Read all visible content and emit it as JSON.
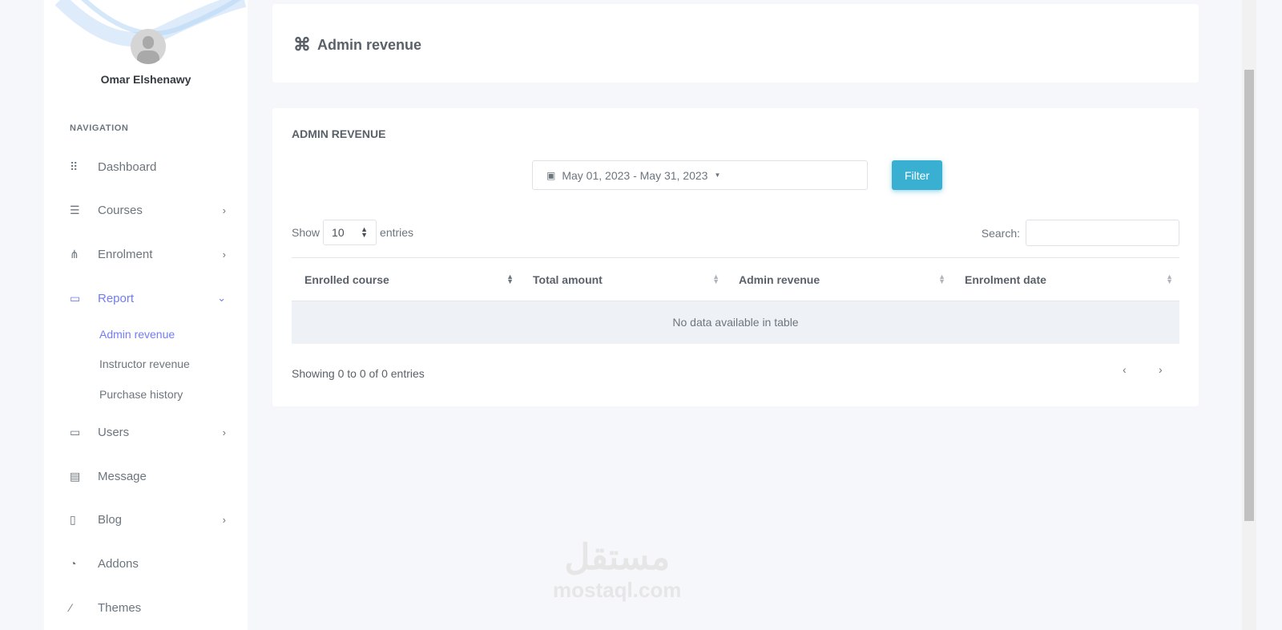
{
  "user": {
    "name": "Omar Elshenawy"
  },
  "nav": {
    "heading": "NAVIGATION",
    "items": [
      {
        "label": "Dashboard",
        "icon": "grid-icon"
      },
      {
        "label": "Courses",
        "icon": "archive-icon"
      },
      {
        "label": "Enrolment",
        "icon": "sitemap-icon"
      },
      {
        "label": "Report",
        "icon": "box-icon"
      },
      {
        "label": "Users",
        "icon": "box-icon"
      },
      {
        "label": "Message",
        "icon": "message-icon"
      },
      {
        "label": "Blog",
        "icon": "document-icon"
      },
      {
        "label": "Addons",
        "icon": "puzzle-icon"
      },
      {
        "label": "Themes",
        "icon": "brush-icon"
      }
    ],
    "report_sub": [
      "Admin revenue",
      "Instructor revenue",
      "Purchase history"
    ]
  },
  "header": {
    "title": "Admin revenue"
  },
  "panel": {
    "title": "ADMIN REVENUE",
    "date_range": "May 01, 2023 - May 31, 2023",
    "filter": "Filter",
    "show": "Show",
    "entries_value": "10",
    "entries": "entries",
    "search_label": "Search:",
    "columns": [
      "Enrolled course",
      "Total amount",
      "Admin revenue",
      "Enrolment date"
    ],
    "empty": "No data available in table",
    "info": "Showing 0 to 0 of 0 entries",
    "prev": "‹",
    "next": "›"
  },
  "watermark": {
    "arabic": "مستقل",
    "latin": "mostaql.com"
  }
}
